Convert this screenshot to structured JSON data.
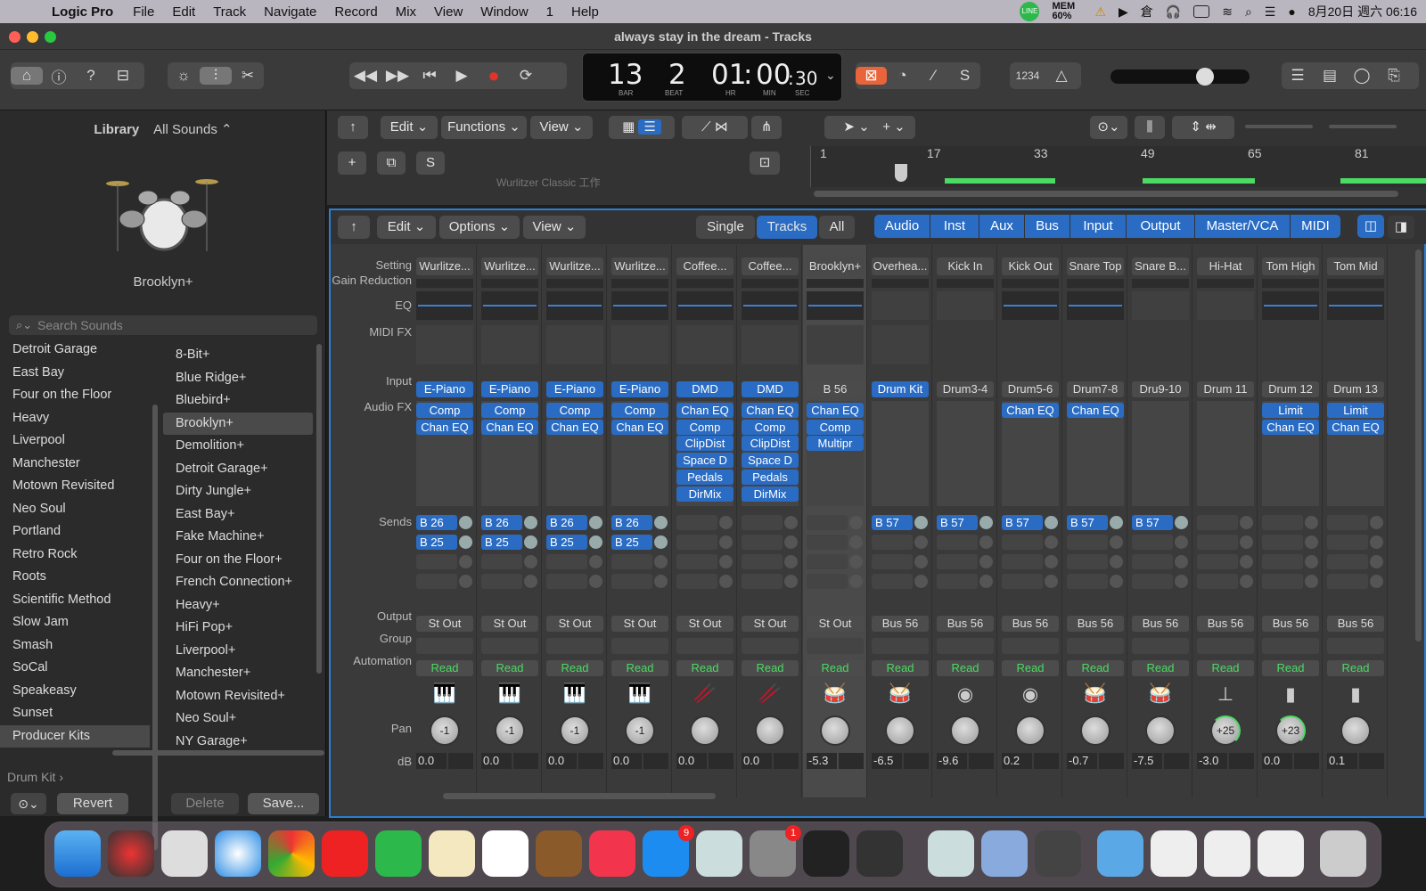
{
  "menubar": {
    "app": "Logic Pro",
    "items": [
      "File",
      "Edit",
      "Track",
      "Navigate",
      "Record",
      "Mix",
      "View",
      "Window",
      "1",
      "Help"
    ],
    "mem": "MEM 60%",
    "datetime": "8月20日 週六 06:16"
  },
  "window": {
    "title": "always stay in the dream - Tracks"
  },
  "lcd": {
    "bar": "13",
    "beat": "2",
    "hr": "01",
    "min": "00",
    "sec": "30",
    "bar_label": "BAR",
    "beat_label": "BEAT",
    "hr_label": "HR",
    "min_label": "MIN",
    "sec_label": "SEC",
    "key": "1234"
  },
  "library": {
    "title": "Library",
    "selector": "All Sounds ⌃",
    "patch": "Brooklyn+",
    "search_placeholder": "Search Sounds",
    "col1": [
      "Detroit Garage",
      "East Bay",
      "Four on the Floor",
      "Heavy",
      "Liverpool",
      "Manchester",
      "Motown Revisited",
      "Neo Soul",
      "Portland",
      "Retro Rock",
      "Roots",
      "Scientific Method",
      "Slow Jam",
      "Smash",
      "SoCal",
      "Speakeasy",
      "Sunset",
      "Producer Kits"
    ],
    "col2": [
      "8-Bit+",
      "Blue Ridge+",
      "Bluebird+",
      "Brooklyn+",
      "Demolition+",
      "Detroit Garage+",
      "Dirty Jungle+",
      "East Bay+",
      "Fake Machine+",
      "Four on the Floor+",
      "French Connection+",
      "Heavy+",
      "HiFi Pop+",
      "Liverpool+",
      "Manchester+",
      "Motown Revisited+",
      "Neo Soul+",
      "NY Garage+"
    ],
    "breadcrumb": "Drum Kit ›",
    "revert": "Revert",
    "delete": "Delete",
    "save": "Save..."
  },
  "tracks": {
    "edit": "Edit",
    "functions": "Functions",
    "view": "View",
    "s_button": "S",
    "ruler": [
      "1",
      "17",
      "33",
      "49",
      "65",
      "81"
    ],
    "track_name": "Wurlitzer Classic 工作"
  },
  "mixer": {
    "edit": "Edit",
    "options": "Options",
    "view": "View",
    "modes": [
      "Single",
      "Tracks",
      "All"
    ],
    "filters": [
      "Audio",
      "Inst",
      "Aux",
      "Bus",
      "Input",
      "Output",
      "Master/VCA",
      "MIDI"
    ],
    "row_labels": [
      "Setting",
      "Gain Reduction",
      "EQ",
      "MIDI FX",
      "Input",
      "Audio FX",
      "Sends",
      "Output",
      "Group",
      "Automation",
      "Pan",
      "dB"
    ],
    "strips": [
      {
        "setting": "Wurlitze...",
        "eq": true,
        "midi": true,
        "input": "E-Piano",
        "in_style": "b",
        "fx": [
          "Comp",
          "Chan EQ"
        ],
        "sends": [
          "B 26",
          "B 25"
        ],
        "out": "St Out",
        "auto": "Read",
        "icon": "piano-icon",
        "glyph": "🎹",
        "pan": "-1",
        "db": "0.0"
      },
      {
        "setting": "Wurlitze...",
        "eq": true,
        "midi": true,
        "input": "E-Piano",
        "in_style": "b",
        "fx": [
          "Comp",
          "Chan EQ"
        ],
        "sends": [
          "B 26",
          "B 25"
        ],
        "out": "St Out",
        "auto": "Read",
        "icon": "piano-icon",
        "glyph": "🎹",
        "pan": "-1",
        "db": "0.0"
      },
      {
        "setting": "Wurlitze...",
        "eq": true,
        "midi": true,
        "input": "E-Piano",
        "in_style": "b",
        "fx": [
          "Comp",
          "Chan EQ"
        ],
        "sends": [
          "B 26",
          "B 25"
        ],
        "out": "St Out",
        "auto": "Read",
        "icon": "piano-icon",
        "glyph": "🎹",
        "pan": "-1",
        "db": "0.0"
      },
      {
        "setting": "Wurlitze...",
        "eq": true,
        "midi": true,
        "input": "E-Piano",
        "in_style": "b",
        "fx": [
          "Comp",
          "Chan EQ"
        ],
        "sends": [
          "B 26",
          "B 25"
        ],
        "out": "St Out",
        "auto": "Read",
        "icon": "piano-icon",
        "glyph": "🎹",
        "pan": "-1",
        "db": "0.0"
      },
      {
        "setting": "Coffee...",
        "eq": true,
        "midi": true,
        "input": "DMD",
        "in_style": "b",
        "fx": [
          "Chan EQ",
          "Comp",
          "ClipDist",
          "Space D",
          "Pedals",
          "DirMix"
        ],
        "sends": [],
        "out": "St Out",
        "auto": "Read",
        "icon": "mallet-icon",
        "glyph": "🥢",
        "pan": "",
        "db": "0.0"
      },
      {
        "setting": "Coffee...",
        "eq": true,
        "midi": true,
        "input": "DMD",
        "in_style": "b",
        "fx": [
          "Chan EQ",
          "Comp",
          "ClipDist",
          "Space D",
          "Pedals",
          "DirMix"
        ],
        "sends": [],
        "out": "St Out",
        "auto": "Read",
        "icon": "mallet-icon",
        "glyph": "🥢",
        "pan": "",
        "db": "0.0"
      },
      {
        "setting": "Brooklyn+",
        "eq": true,
        "midi": true,
        "input": "B 56",
        "in_style": "g",
        "fx": [
          "Chan EQ",
          "Comp",
          "Multipr"
        ],
        "sends": [],
        "out": "St Out",
        "auto": "Read",
        "icon": "drumkit-icon",
        "glyph": "🥁",
        "pan": "",
        "db": "-5.3",
        "sel": true
      },
      {
        "setting": "Overhea...",
        "eq": false,
        "midi": true,
        "input": "Drum Kit",
        "in_style": "b",
        "fx": [],
        "sends": [
          "B 57"
        ],
        "out": "Bus 56",
        "auto": "Read",
        "icon": "drumkit-icon",
        "glyph": "🥁",
        "pan": "",
        "db": "-6.5"
      },
      {
        "setting": "Kick In",
        "eq": false,
        "midi": false,
        "input": "Drum3-4",
        "in_style": "g",
        "fx": [],
        "sends": [
          "B 57"
        ],
        "out": "Bus 56",
        "auto": "Read",
        "icon": "kick-icon",
        "glyph": "◉",
        "pan": "",
        "db": "-9.6"
      },
      {
        "setting": "Kick Out",
        "eq": true,
        "midi": false,
        "input": "Drum5-6",
        "in_style": "g",
        "fx": [
          "Chan EQ"
        ],
        "sends": [
          "B 57"
        ],
        "out": "Bus 56",
        "auto": "Read",
        "icon": "kick-icon",
        "glyph": "◉",
        "pan": "",
        "db": "0.2"
      },
      {
        "setting": "Snare Top",
        "eq": true,
        "midi": false,
        "input": "Drum7-8",
        "in_style": "g",
        "fx": [
          "Chan EQ"
        ],
        "sends": [
          "B 57"
        ],
        "out": "Bus 56",
        "auto": "Read",
        "icon": "snare-icon",
        "glyph": "🥁",
        "pan": "",
        "db": "-0.7"
      },
      {
        "setting": "Snare B...",
        "eq": false,
        "midi": false,
        "input": "Dru9-10",
        "in_style": "g",
        "fx": [],
        "sends": [
          "B 57"
        ],
        "out": "Bus 56",
        "auto": "Read",
        "icon": "snare-icon",
        "glyph": "🥁",
        "pan": "",
        "db": "-7.5"
      },
      {
        "setting": "Hi-Hat",
        "eq": false,
        "midi": false,
        "input": "Drum 11",
        "in_style": "g",
        "fx": [],
        "sends": [],
        "out": "Bus 56",
        "auto": "Read",
        "icon": "hihat-icon",
        "glyph": "⊥",
        "pan": "+25",
        "db": "-3.0",
        "arc": true
      },
      {
        "setting": "Tom High",
        "eq": true,
        "midi": false,
        "input": "Drum 12",
        "in_style": "g",
        "fx": [
          "Limit",
          "Chan EQ"
        ],
        "sends": [],
        "out": "Bus 56",
        "auto": "Read",
        "icon": "tom-icon",
        "glyph": "▮",
        "pan": "+23",
        "db": "0.0",
        "arc": true
      },
      {
        "setting": "Tom Mid",
        "eq": true,
        "midi": false,
        "input": "Drum 13",
        "in_style": "g",
        "fx": [
          "Limit",
          "Chan EQ"
        ],
        "sends": [],
        "out": "Bus 56",
        "auto": "Read",
        "icon": "tom-icon",
        "glyph": "▮",
        "pan": "",
        "db": "0.1"
      }
    ]
  },
  "colors": {
    "accent": "#2a6cc4",
    "automation": "#4cd964",
    "record": "#e0352b",
    "cycle_on": "#e8643a"
  },
  "dock": {
    "badge_appstore": "9",
    "badge_settings": "1"
  }
}
